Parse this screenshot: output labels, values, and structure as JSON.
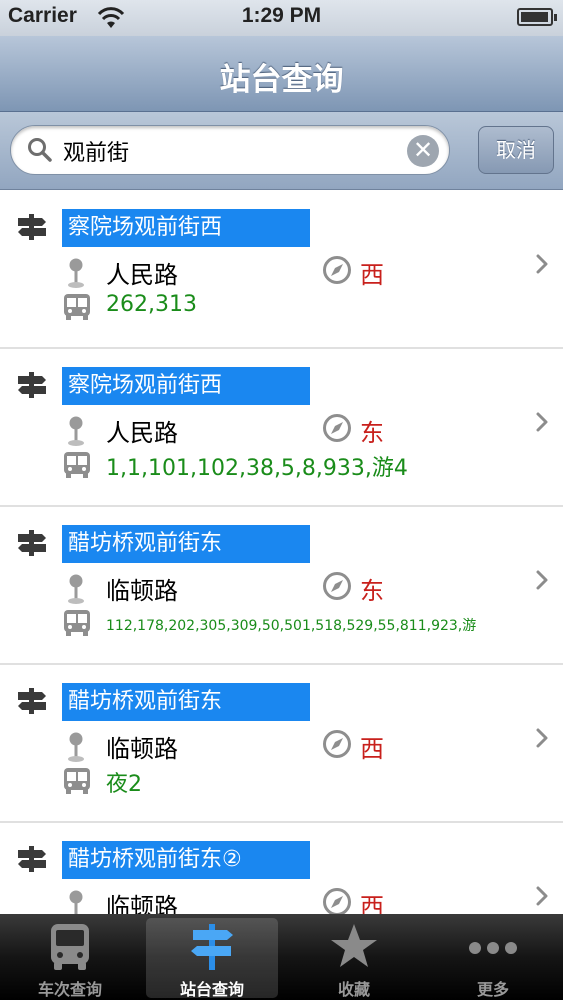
{
  "status_bar": {
    "carrier": "Carrier",
    "time": "1:29 PM",
    "battery_level": 0.95
  },
  "nav": {
    "title": "站台查询"
  },
  "search": {
    "value": "观前街",
    "clear_glyph": "✕",
    "cancel_label": "取消"
  },
  "results": [
    {
      "name": "察院场观前街西",
      "road": "人民路",
      "direction": "西",
      "routes": "262,313"
    },
    {
      "name": "察院场观前街西",
      "road": "人民路",
      "direction": "东",
      "routes": "1,1,101,102,38,5,8,933,游4"
    },
    {
      "name": "醋坊桥观前街东",
      "road": "临顿路",
      "direction": "东",
      "routes": "112,178,202,305,309,50,501,518,529,55,811,923,游"
    },
    {
      "name": "醋坊桥观前街东",
      "road": "临顿路",
      "direction": "西",
      "routes": "夜2"
    },
    {
      "name": "醋坊桥观前街东②",
      "road": "临顿路",
      "direction": "西",
      "routes": ""
    }
  ],
  "tab_bar": {
    "tabs": [
      {
        "label": "车次查询",
        "icon": "bus-icon"
      },
      {
        "label": "站台查询",
        "icon": "signpost-icon",
        "selected": true
      },
      {
        "label": "收藏",
        "icon": "star-icon"
      },
      {
        "label": "更多",
        "icon": "more-icon"
      }
    ]
  },
  "colors": {
    "stop_name_bg": "#1a87f0",
    "direction_text": "#c8201c",
    "routes_text": "#1a8c1a"
  }
}
